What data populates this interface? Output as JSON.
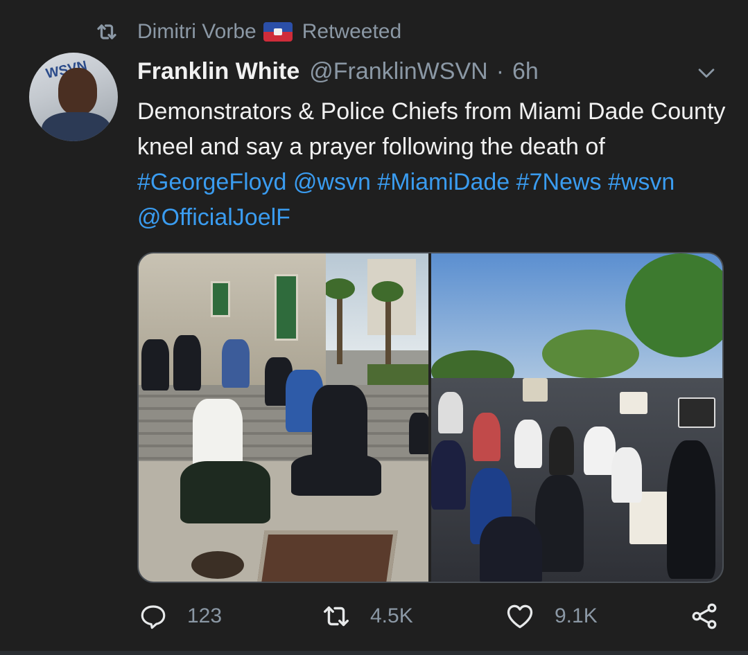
{
  "retweet": {
    "icon": "retweet-icon",
    "name": "Dimitri Vorbe",
    "flag": "haiti-flag",
    "label": "Retweeted"
  },
  "tweet": {
    "author": "Franklin White",
    "handle": "@FranklinWSVN",
    "separator": "·",
    "time": "6h",
    "menu_icon": "chevron-down-icon",
    "text": {
      "line_plain": "Demonstrators & Police Chiefs from Miami Dade County kneel and say a prayer following the death of ",
      "tags": [
        "#GeorgeFloyd",
        "@wsvn",
        "#MiamiDade",
        "#7News",
        "#wsvn",
        "@OfficialJoelF"
      ]
    },
    "media": [
      {
        "name": "photo-police-kneeling",
        "icon": "photo"
      },
      {
        "name": "photo-demonstrators-kneeling",
        "icon": "photo"
      }
    ]
  },
  "actions": {
    "reply": {
      "icon": "reply-icon",
      "count": "123"
    },
    "retweet": {
      "icon": "retweet-icon",
      "count": "4.5K"
    },
    "like": {
      "icon": "heart-icon",
      "count": "9.1K"
    },
    "share": {
      "icon": "share-icon"
    }
  },
  "colors": {
    "background": "#1f1f1f",
    "text": "#f1f1f1",
    "muted": "#8b98a5",
    "link": "#3a9cf0"
  }
}
